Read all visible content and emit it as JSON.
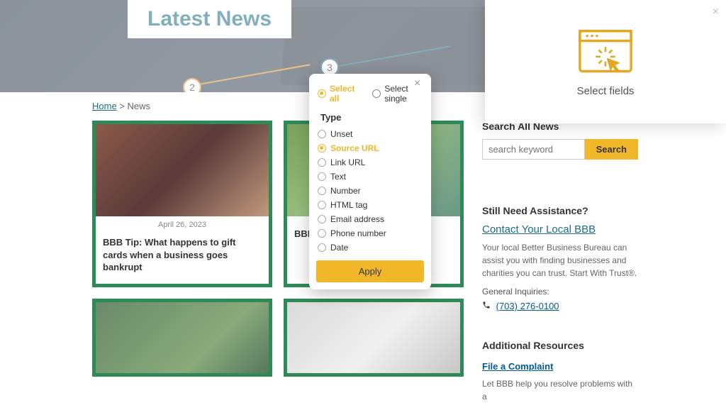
{
  "hero": {
    "title": "Latest News",
    "step2": "2",
    "step3": "3"
  },
  "breadcrumb": {
    "home": "Home",
    "sep": ">",
    "current": "News"
  },
  "cards": [
    {
      "date": "April 26, 2023",
      "title": "BBB Tip: What happens to gift cards when a business goes bankrupt"
    },
    {
      "date": "",
      "title": "BBB\nunet"
    },
    {
      "date": "",
      "title": ""
    },
    {
      "date": "",
      "title": ""
    }
  ],
  "sidebar": {
    "search": {
      "heading": "Search All News",
      "placeholder": "search keyword",
      "btn": "Search"
    },
    "assist": {
      "heading": "Still Need Assistance?",
      "contact": "Contact Your Local BBB",
      "text": "Your local Better Business Bureau can assist you with finding businesses and charities you can trust. Start With Trust®.",
      "inquiries": "General Inquiries:",
      "phone": "(703) 276-0100"
    },
    "resources": {
      "heading": "Additional Resources",
      "link": "File a Complaint",
      "text": "Let BBB help you resolve problems with a"
    }
  },
  "popup": {
    "mode_select_all": "Select all",
    "mode_select_single": "Select single",
    "type_heading": "Type",
    "options": [
      "Unset",
      "Source URL",
      "Link URL",
      "Text",
      "Number",
      "HTML tag",
      "Email address",
      "Phone number",
      "Date"
    ],
    "selected_index": 1,
    "apply": "Apply"
  },
  "ext": {
    "label": "Select fields"
  }
}
